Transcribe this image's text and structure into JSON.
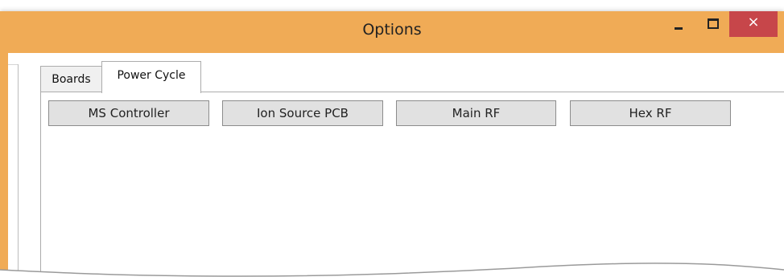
{
  "window": {
    "title": "Options",
    "accent_color": "#f0ab56",
    "close_color": "#c7464a",
    "minimize_icon": "minimize-icon",
    "maximize_icon": "maximize-icon",
    "close_icon": "close-icon",
    "close_glyph": "×"
  },
  "tabs": [
    {
      "label": "Boards",
      "selected": false
    },
    {
      "label": "Power Cycle",
      "selected": true
    }
  ],
  "power_cycle": {
    "buttons": [
      {
        "label": "MS Controller"
      },
      {
        "label": "Ion Source PCB"
      },
      {
        "label": "Main RF"
      },
      {
        "label": "Hex RF"
      }
    ]
  }
}
